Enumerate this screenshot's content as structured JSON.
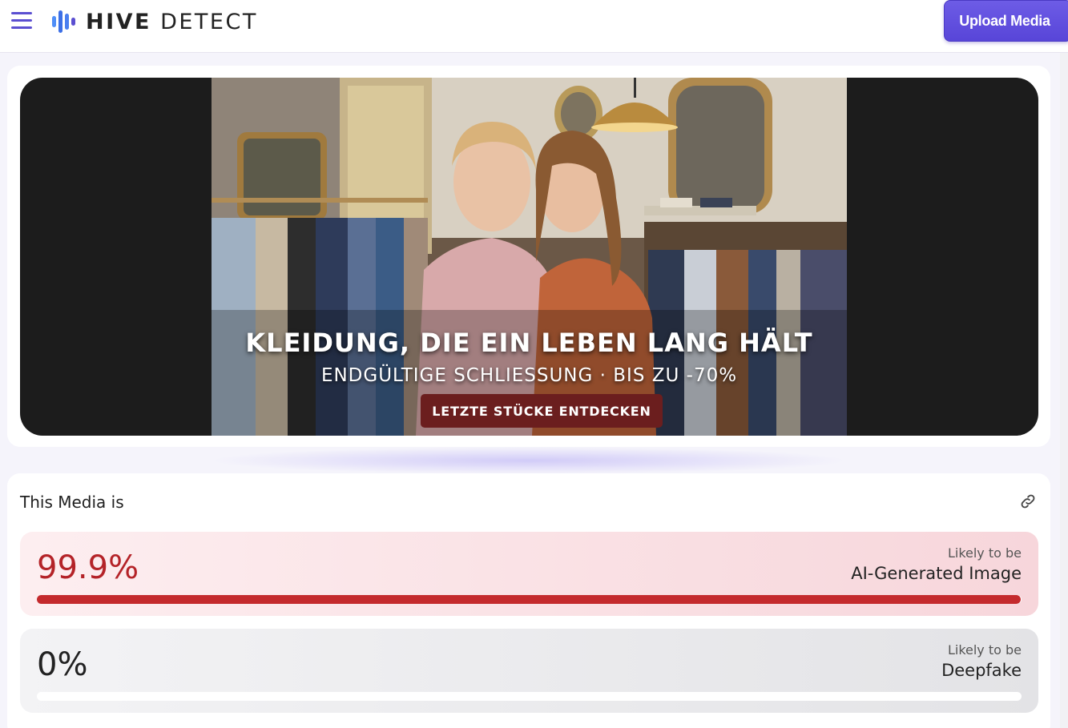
{
  "header": {
    "brand_bold": "HIVE",
    "brand_light": " DETECT",
    "upload_label": "Upload Media",
    "accent_color": "#5b4fd1"
  },
  "media": {
    "headline": "KLEIDUNG, DIE EIN LEBEN LANG HÄLT",
    "subline": "ENDGÜLTIGE SCHLIESSUNG · BIS ZU -70%",
    "cta": "LETZTE STÜCKE ENTDECKEN"
  },
  "result": {
    "title": "This Media is",
    "scores": [
      {
        "value": "99.9%",
        "fraction": 0.999,
        "likely": "Likely to be",
        "label": "AI-Generated Image",
        "color": "#c42a2d"
      },
      {
        "value": "0%",
        "fraction": 0,
        "likely": "Likely to be",
        "label": "Deepfake",
        "color": "#c42a2d"
      }
    ]
  }
}
